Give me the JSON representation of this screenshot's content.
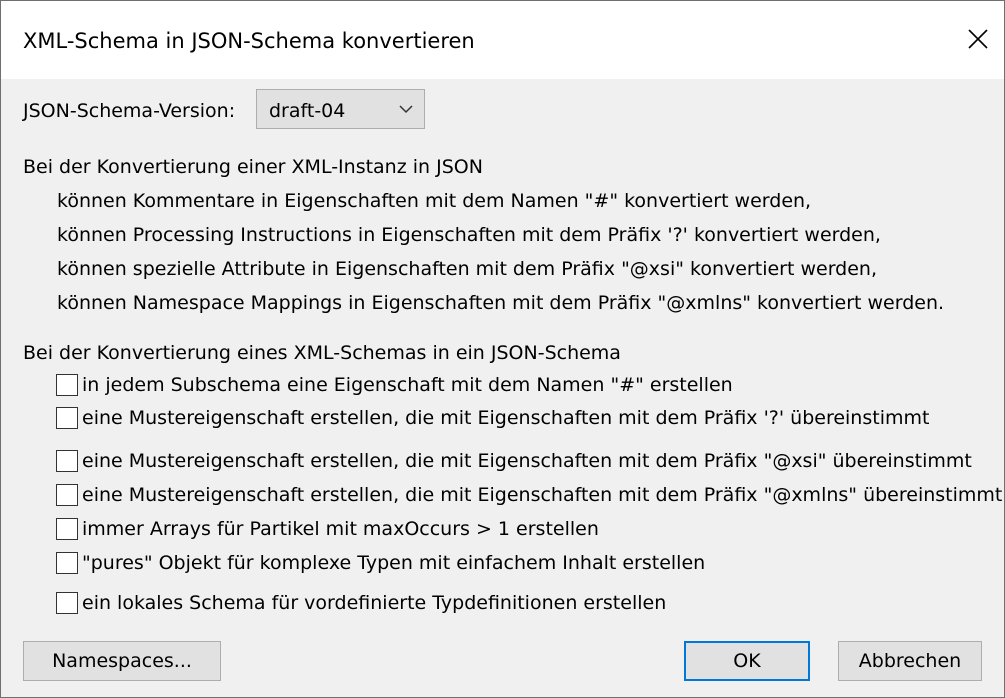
{
  "dialog": {
    "title": "XML-Schema in JSON-Schema konvertieren",
    "close_icon": "close-icon"
  },
  "version": {
    "label": "JSON-Schema-Version:",
    "selected": "draft-04",
    "chevron_icon": "chevron-down-icon"
  },
  "instance_section": {
    "heading": "Bei der Konvertierung einer XML-Instanz in JSON",
    "lines": [
      "können Kommentare in Eigenschaften mit dem Namen \"#\" konvertiert werden,",
      "können Processing Instructions in Eigenschaften mit dem Präfix '?' konvertiert werden,",
      "können spezielle Attribute in Eigenschaften mit dem Präfix \"@xsi\" konvertiert werden,",
      "können Namespace Mappings in Eigenschaften mit dem Präfix \"@xmlns\" konvertiert werden."
    ]
  },
  "schema_section": {
    "heading": "Bei der Konvertierung eines XML-Schemas in ein JSON-Schema",
    "options": [
      {
        "label": "in jedem Subschema eine Eigenschaft mit dem Namen \"#\" erstellen",
        "checked": false
      },
      {
        "label": "eine Mustereigenschaft erstellen, die mit Eigenschaften mit dem Präfix '?' übereinstimmt",
        "checked": false
      },
      {
        "label": "eine Mustereigenschaft erstellen, die mit Eigenschaften mit dem Präfix \"@xsi\" übereinstimmt",
        "checked": false
      },
      {
        "label": "eine Mustereigenschaft erstellen, die mit Eigenschaften mit dem Präfix \"@xmlns\" übereinstimmt",
        "checked": false
      },
      {
        "label": "immer Arrays für Partikel mit maxOccurs > 1 erstellen",
        "checked": false
      },
      {
        "label": "\"pures\" Objekt für komplexe Typen mit einfachem Inhalt erstellen",
        "checked": false
      },
      {
        "label": "ein lokales Schema für vordefinierte Typdefinitionen erstellen",
        "checked": false
      }
    ]
  },
  "buttons": {
    "namespaces": "Namespaces...",
    "ok": "OK",
    "cancel": "Abbrechen"
  },
  "colors": {
    "dialog_background": "#f0f0f0",
    "titlebar_background": "#ffffff",
    "button_face": "#e1e1e1",
    "button_border": "#adadad",
    "default_button_accent": "#0078d7"
  }
}
